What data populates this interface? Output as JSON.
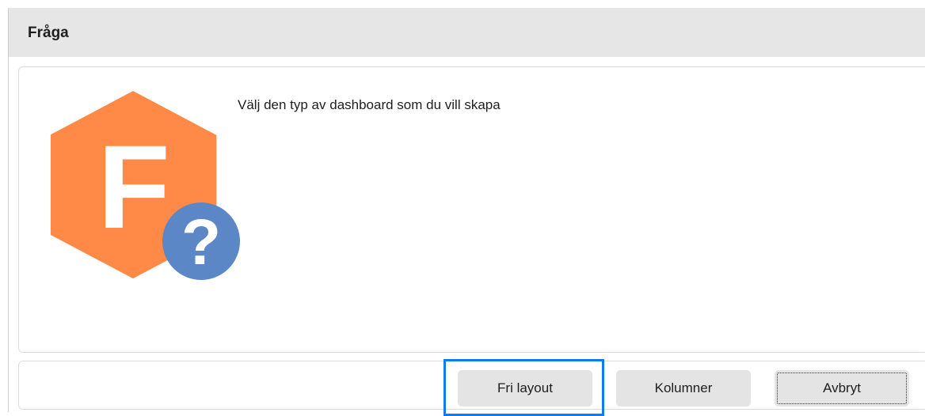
{
  "dialog": {
    "title": "Fråga",
    "message": "Välj den typ av dashboard som du vill skapa",
    "icon": {
      "name": "app-question-icon",
      "letter": "F",
      "symbol": "?",
      "hex_color": "#FF8A47",
      "badge_color": "#5B87C7"
    }
  },
  "buttons": {
    "fri_layout": "Fri layout",
    "kolumner": "Kolumner",
    "avbryt": "Avbryt"
  },
  "colors": {
    "titlebar": "#E6E6E6",
    "button": "#E4E4E4",
    "focus": "#0A7CF5"
  }
}
